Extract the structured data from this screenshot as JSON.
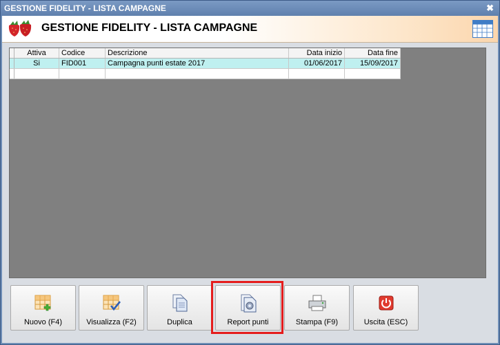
{
  "window": {
    "title": "GESTIONE FIDELITY - LISTA CAMPAGNE",
    "close_label": "✖"
  },
  "header": {
    "title": "GESTIONE FIDELITY - LISTA CAMPAGNE",
    "logo_icon": "strawberries-icon",
    "calendar_icon": "calendar-icon"
  },
  "grid": {
    "columns": [
      "Attiva",
      "Codice",
      "Descrizione",
      "Data inizio",
      "Data fine"
    ],
    "rows": [
      {
        "attiva": "Si",
        "codice": "FID001",
        "descrizione": "Campagna punti estate 2017",
        "data_inizio": "01/06/2017",
        "data_fine": "15/09/2017",
        "selected": true
      }
    ]
  },
  "toolbar": {
    "buttons": [
      {
        "label": "Nuovo (F4)",
        "icon": "grid-add-icon"
      },
      {
        "label": "Visualizza (F2)",
        "icon": "grid-check-icon"
      },
      {
        "label": "Duplica",
        "icon": "copy-documents-icon"
      },
      {
        "label": "Report punti",
        "icon": "report-gear-icon"
      },
      {
        "label": "Stampa (F9)",
        "icon": "printer-icon"
      },
      {
        "label": "Uscita (ESC)",
        "icon": "power-icon"
      }
    ]
  },
  "colors": {
    "selected_row": "#bff0f0",
    "highlight": "#e51c1c",
    "title_bar": "#6d8db6",
    "grid_background": "#808080"
  }
}
